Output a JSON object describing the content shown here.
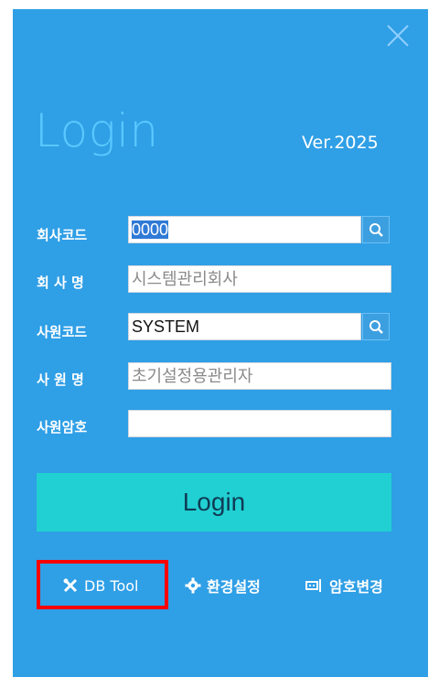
{
  "header": {
    "title": "Login",
    "version": "Ver.2025"
  },
  "form": {
    "company_code": {
      "label": "회사코드",
      "value": "0000"
    },
    "company_name": {
      "label": "회 사 명",
      "value": "시스템관리회사"
    },
    "employee_code": {
      "label": "사원코드",
      "value": "SYSTEM"
    },
    "employee_name": {
      "label": "사 원 명",
      "value": "초기설정용관리자"
    },
    "password": {
      "label": "사원암호",
      "value": ""
    }
  },
  "actions": {
    "login_label": "Login",
    "db_tool_label": "DB Tool",
    "settings_label": "환경설정",
    "change_password_label": "암호변경"
  },
  "colors": {
    "panel": "#2f9fe6",
    "login_button": "#21d0d2",
    "highlight": "#ff0000"
  }
}
